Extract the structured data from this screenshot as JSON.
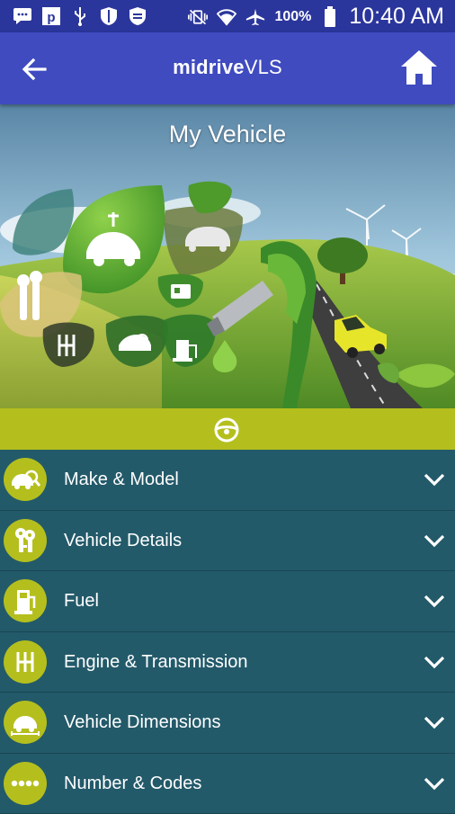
{
  "status_bar": {
    "battery_percent": "100%",
    "time": "10:40 AM",
    "icons": [
      "message-icon",
      "p-app-icon",
      "usb-icon",
      "shield-icon",
      "shield-icon",
      "vibrate-icon",
      "wifi-icon",
      "airplane-icon",
      "battery-icon"
    ]
  },
  "app_bar": {
    "title_bold": "midrive",
    "title_light": "VLS",
    "back_icon": "arrow-back-icon",
    "home_icon": "home-icon"
  },
  "hero": {
    "title": "My Vehicle"
  },
  "tab_strip": {
    "icon": "steering-wheel-icon"
  },
  "sections": [
    {
      "label": "Make & Model",
      "icon": "car-search-icon"
    },
    {
      "label": "Vehicle Details",
      "icon": "keys-icon"
    },
    {
      "label": "Fuel",
      "icon": "fuel-pump-icon"
    },
    {
      "label": "Engine & Transmission",
      "icon": "gear-shift-icon"
    },
    {
      "label": "Vehicle Dimensions",
      "icon": "car-dimensions-icon"
    },
    {
      "label": "Number & Codes",
      "icon": "dots-icon"
    }
  ],
  "colors": {
    "status_bar": "#2b369c",
    "app_bar": "#3f4bbf",
    "accent_lime": "#b4bf1e",
    "list_row": "#235a6a"
  }
}
